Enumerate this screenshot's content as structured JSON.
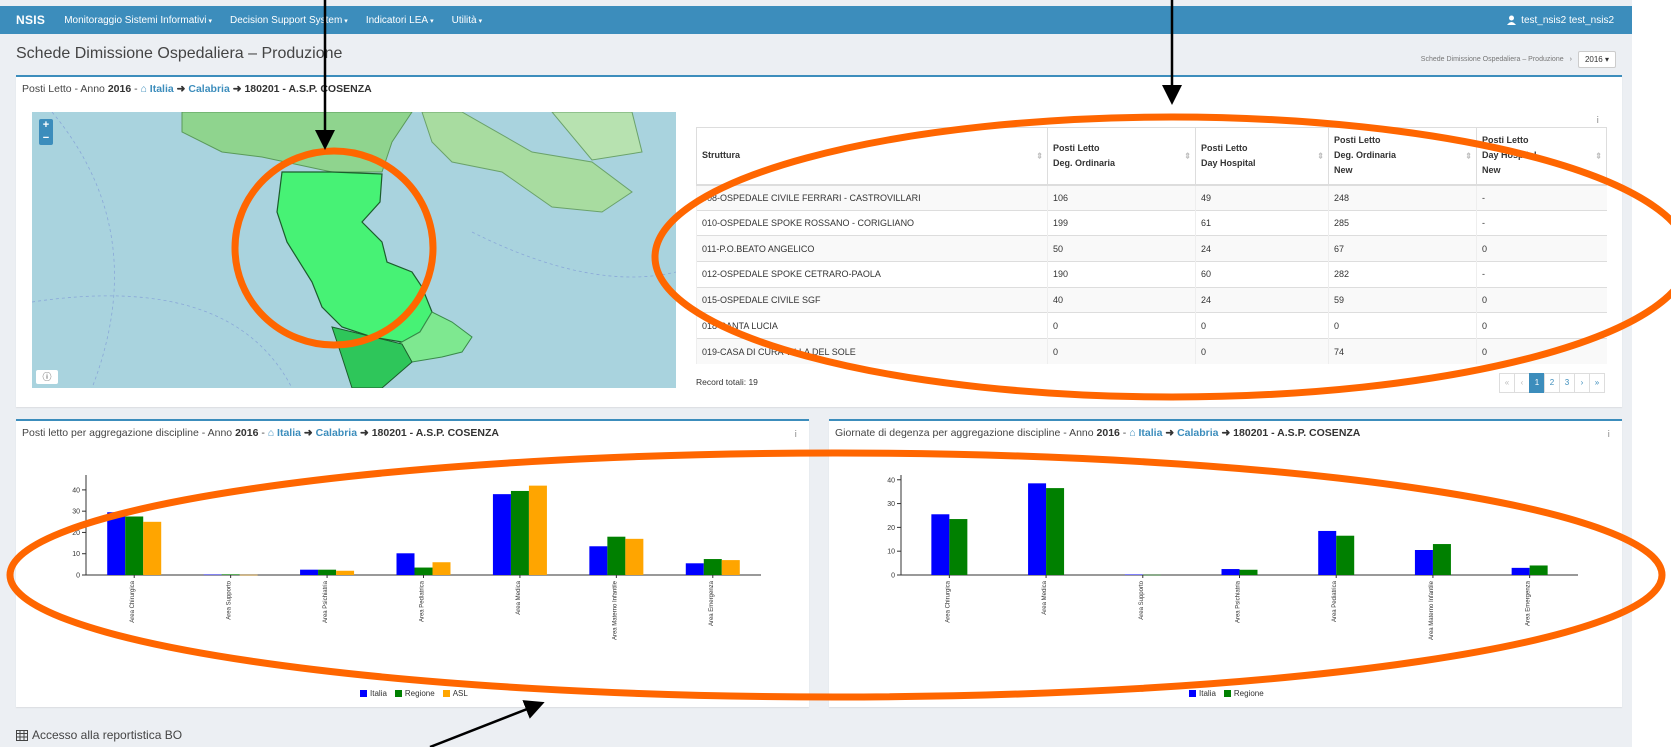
{
  "nav": {
    "brand": "NSIS",
    "menus": [
      "Monitoraggio Sistemi Informativi",
      "Decision Support System",
      "Indicatori LEA",
      "Utilità"
    ],
    "user": "test_nsis2 test_nsis2"
  },
  "header": {
    "title": "Schede Dimissione Ospedaliera – Produzione",
    "breadcrumb": "Schede Dimissione Ospedaliera – Produzione",
    "year": "2016"
  },
  "top_box": {
    "prefix": "Posti Letto - Anno",
    "year": "2016",
    "country": "Italia",
    "region": "Calabria",
    "asl": "180201 - A.S.P. COSENZA"
  },
  "table": {
    "columns": [
      {
        "l1": "Struttura",
        "l2": "",
        "l3": ""
      },
      {
        "l1": "Posti Letto",
        "l2": "Deg. Ordinaria",
        "l3": ""
      },
      {
        "l1": "Posti Letto",
        "l2": "Day Hospital",
        "l3": ""
      },
      {
        "l1": "Posti Letto",
        "l2": "Deg. Ordinaria",
        "l3": "New"
      },
      {
        "l1": "Posti Letto",
        "l2": "Day Hospital",
        "l3": "New"
      }
    ],
    "rows": [
      [
        "008-OSPEDALE CIVILE FERRARI - CASTROVILLARI",
        "106",
        "49",
        "248",
        "-"
      ],
      [
        "010-OSPEDALE SPOKE ROSSANO - CORIGLIANO",
        "199",
        "61",
        "285",
        "-"
      ],
      [
        "011-P.O.BEATO ANGELICO",
        "50",
        "24",
        "67",
        "0"
      ],
      [
        "012-OSPEDALE SPOKE CETRARO-PAOLA",
        "190",
        "60",
        "282",
        "-"
      ],
      [
        "015-OSPEDALE CIVILE SGF",
        "40",
        "24",
        "59",
        "0"
      ],
      [
        "018-SANTA LUCIA",
        "0",
        "0",
        "0",
        "0"
      ],
      [
        "019-CASA DI CURA VILLA DEL SOLE",
        "0",
        "0",
        "74",
        "0"
      ]
    ],
    "record_total": "Record totali: 19",
    "pages": [
      "«",
      "‹",
      "1",
      "2",
      "3",
      "›",
      "»"
    ]
  },
  "left_box": {
    "prefix": "Posti letto per aggregazione discipline - Anno",
    "year": "2016",
    "country": "Italia",
    "region": "Calabria",
    "asl": "180201 - A.S.P. COSENZA"
  },
  "right_box": {
    "prefix": "Giornate di degenza per aggregazione discipline - Anno",
    "year": "2016",
    "country": "Italia",
    "region": "Calabria",
    "asl": "180201 - A.S.P. COSENZA"
  },
  "chart_data": [
    {
      "type": "bar",
      "title": "",
      "categories": [
        "Area Chirurgica",
        "Area Supporto",
        "Area Psichiatria",
        "Area Pediatrica",
        "Area Medica",
        "Area Materno Infantile",
        "Area Emergenza"
      ],
      "series": [
        {
          "name": "Italia",
          "color": "#0000ff",
          "values": [
            29.5,
            0.2,
            2.5,
            10.2,
            38,
            13.5,
            5.5
          ]
        },
        {
          "name": "Regione",
          "color": "#008000",
          "values": [
            27.5,
            0.3,
            2.5,
            3.5,
            39.5,
            18,
            7.5
          ]
        },
        {
          "name": "ASL",
          "color": "#ffa500",
          "values": [
            25,
            0.1,
            2,
            6,
            42,
            17,
            7
          ]
        }
      ],
      "ylim": [
        0,
        47
      ],
      "yticks": [
        0,
        10,
        20,
        30,
        40
      ],
      "legend": "bottom"
    },
    {
      "type": "bar",
      "title": "",
      "categories": [
        "Area Chirurgica",
        "Area Medica",
        "Area Supporto",
        "Area Psichiatria",
        "Area Pediatrica",
        "Area Materno Infantile",
        "Area Emergenza"
      ],
      "series": [
        {
          "name": "Italia",
          "color": "#0000ff",
          "values": [
            25.5,
            38.5,
            0.2,
            2.5,
            18.5,
            10.5,
            3
          ]
        },
        {
          "name": "Regione",
          "color": "#008000",
          "values": [
            23.5,
            36.5,
            0.1,
            2.2,
            16.5,
            13,
            4
          ]
        }
      ],
      "ylim": [
        0,
        42
      ],
      "yticks": [
        0,
        10,
        20,
        30,
        40
      ],
      "legend": "bottom"
    }
  ],
  "footer": {
    "bo_link": "Accesso alla reportistica BO"
  },
  "colors": {
    "primary": "#3c8dbc",
    "annotation": "#ff6600"
  }
}
